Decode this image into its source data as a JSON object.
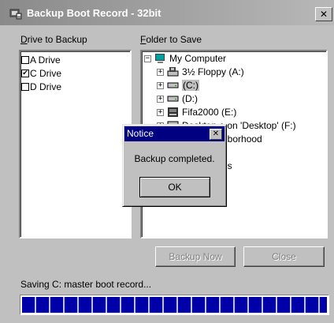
{
  "window": {
    "title": "Backup Boot Record - 32bit",
    "close_glyph": "✕"
  },
  "drives": {
    "label_accel": "D",
    "label_rest": "rive to Backup",
    "items": [
      {
        "label": "A Drive",
        "checked": false
      },
      {
        "label": "C Drive",
        "checked": true
      },
      {
        "label": "D Drive",
        "checked": false
      }
    ]
  },
  "folder": {
    "label_accel": "F",
    "label_rest": "older to Save",
    "tree": [
      {
        "label": "My Computer",
        "icon": "computer-icon",
        "expander": "−"
      },
      {
        "label": "3½ Floppy (A:)",
        "icon": "floppy-icon",
        "expander": "+"
      },
      {
        "label": "(C:)",
        "icon": "hard-drive-icon",
        "expander": "+",
        "selected": true
      },
      {
        "label": "(D:)",
        "icon": "hard-drive-icon",
        "expander": "+"
      },
      {
        "label": "Fifa2000 (E:)",
        "icon": "cd-drive-icon",
        "expander": "+"
      },
      {
        "label": "Desktop e on 'Desktop' (F:)",
        "icon": "network-drive-icon",
        "expander": "+"
      },
      {
        "label": "nborhood",
        "icon": "network-neighborhood-icon",
        "expander": ""
      },
      {
        "label": "s",
        "icon": "",
        "expander": ""
      },
      {
        "label": "es",
        "icon": "",
        "expander": ""
      }
    ]
  },
  "buttons": {
    "backup_now": "Backup Now",
    "close": "Close"
  },
  "status": {
    "text": "Saving C: master boot record...",
    "progress": 1.0
  },
  "dialog": {
    "title": "Notice",
    "close_glyph": "✕",
    "message": "Backup completed.",
    "ok": "OK"
  },
  "colors": {
    "progress_fill": "#0000a8",
    "dialog_title_bg": "#000080"
  }
}
